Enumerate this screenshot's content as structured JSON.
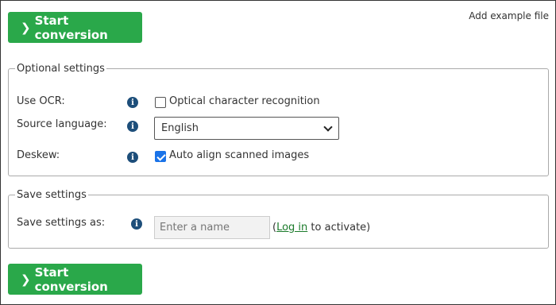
{
  "buttons": {
    "start_conversion": "Start conversion"
  },
  "add_example_file": "Add example file",
  "optional_settings": {
    "legend": "Optional settings",
    "ocr": {
      "label": "Use OCR:",
      "checkbox_label": "Optical character recognition",
      "checked": false
    },
    "source_language": {
      "label": "Source language:",
      "selected": "English"
    },
    "deskew": {
      "label": "Deskew:",
      "checkbox_label": "Auto align scanned images",
      "checked": true
    }
  },
  "save_settings": {
    "legend": "Save settings",
    "label": "Save settings as:",
    "input_placeholder": "Enter a name",
    "login_prefix": "(",
    "login_link": "Log in",
    "login_suffix": " to activate)"
  },
  "colors": {
    "button_green": "#2aa84a",
    "info_blue": "#1d4e7a",
    "link_green": "#1a7a2a",
    "checkbox_blue": "#1a73e8"
  }
}
